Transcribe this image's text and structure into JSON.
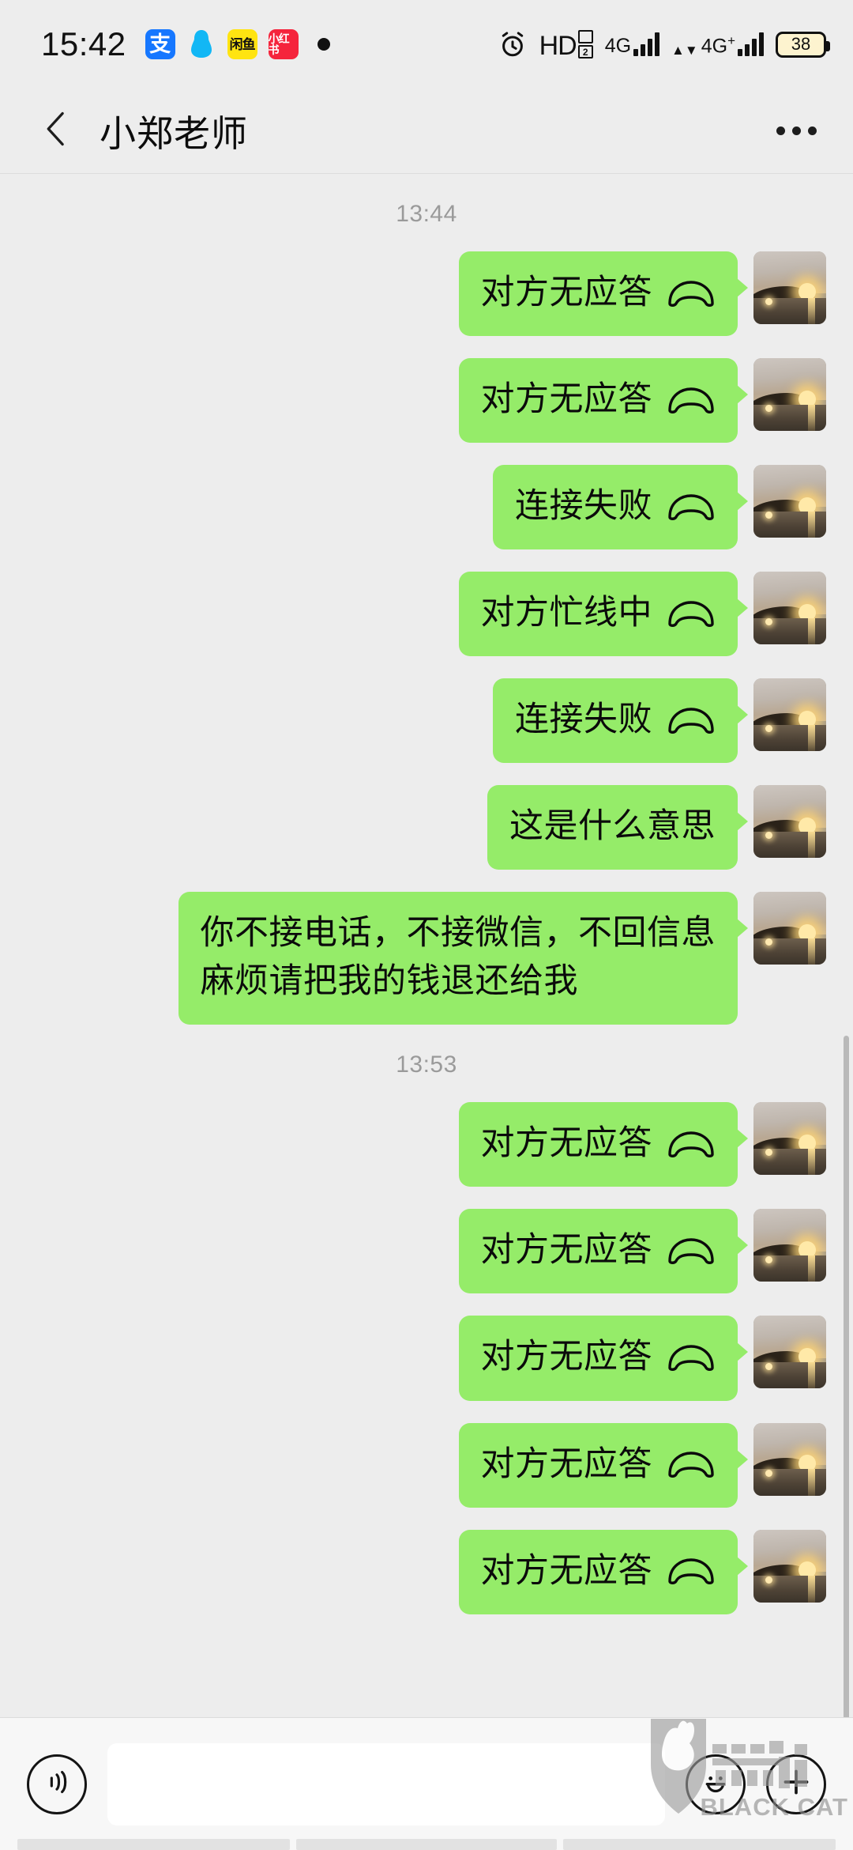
{
  "status_bar": {
    "time": "15:42",
    "app_icons": [
      {
        "name": "alipay-icon",
        "glyph": "支"
      },
      {
        "name": "qq-icon",
        "glyph": ""
      },
      {
        "name": "xianyu-icon",
        "glyph": "闲鱼"
      },
      {
        "name": "xiaohongshu-icon",
        "glyph": "小红书"
      }
    ],
    "hd_label": "HD",
    "hd_sim": "2",
    "sim1_network": "4G",
    "sim2_network": "4G",
    "sim2_network_suffix": "+",
    "battery_level": "38",
    "colors": {
      "alipay": "#1677ff",
      "qq": "#12b7f5",
      "xianyu": "#ffe411",
      "xiaohongshu": "#f5243c",
      "battery_fill": "#fdf3cf"
    }
  },
  "nav_bar": {
    "back_label": "返回",
    "title": "小郑老师",
    "more_label": "更多"
  },
  "chat": {
    "background_color": "#ededed",
    "bubble_color": "#95ec69",
    "groups": [
      {
        "timestamp": "13:44",
        "messages": [
          {
            "text": "对方无应答",
            "has_phone_icon": true,
            "outgoing": true
          },
          {
            "text": "对方无应答",
            "has_phone_icon": true,
            "outgoing": true
          },
          {
            "text": "连接失败",
            "has_phone_icon": true,
            "outgoing": true
          },
          {
            "text": "对方忙线中",
            "has_phone_icon": true,
            "outgoing": true
          },
          {
            "text": "连接失败",
            "has_phone_icon": true,
            "outgoing": true
          },
          {
            "text": "这是什么意思",
            "has_phone_icon": false,
            "outgoing": true
          },
          {
            "text": "你不接电话，不接微信，不回信息\n麻烦请把我的钱退还给我",
            "has_phone_icon": false,
            "outgoing": true
          }
        ]
      },
      {
        "timestamp": "13:53",
        "messages": [
          {
            "text": "对方无应答",
            "has_phone_icon": true,
            "outgoing": true
          },
          {
            "text": "对方无应答",
            "has_phone_icon": true,
            "outgoing": true
          },
          {
            "text": "对方无应答",
            "has_phone_icon": true,
            "outgoing": true
          },
          {
            "text": "对方无应答",
            "has_phone_icon": true,
            "outgoing": true
          },
          {
            "text": "对方无应答",
            "has_phone_icon": true,
            "outgoing": true
          }
        ]
      }
    ]
  },
  "input_bar": {
    "voice_label": "语音",
    "text_value": "",
    "placeholder": "",
    "emoji_label": "表情",
    "plus_label": "更多功能"
  },
  "watermark": {
    "text": "BLACK CAT"
  }
}
